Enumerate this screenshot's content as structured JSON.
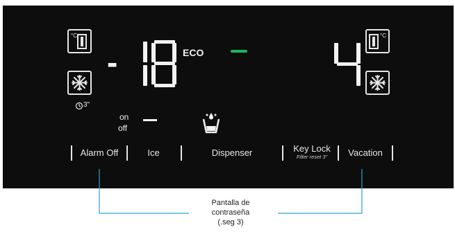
{
  "display": {
    "freezer_temp_digits": "18",
    "freezer_temp_sign": "-",
    "eco_label": "ECO",
    "fridge_temp_digit": "4",
    "eco_indicator_color": "#1db954",
    "hold_hint": "3\""
  },
  "ice_status": {
    "on_label": "on",
    "off_label": "off"
  },
  "controls": {
    "alarm_off": "Alarm Off",
    "ice": "Ice",
    "dispenser": "Dispenser",
    "key_lock": "Key Lock",
    "key_lock_sub": "Filter reset 3\"",
    "vacation": "Vacation"
  },
  "annotation": {
    "line1": "Pantalla de",
    "line2": "contraseña",
    "line3": "(.seg 3)",
    "line_color": "#2aa0d8"
  },
  "icons": {
    "freezer_temp": "thermometer-celsius-icon",
    "freezer_mode": "snowflake-icon",
    "fridge_temp": "thermometer-celsius-icon",
    "fridge_mode": "snowflake-icon",
    "dispenser": "water-glass-icon",
    "power_freeze_timer": "clock-timer-icon"
  },
  "colors": {
    "panel_bg": "#0d0d0d",
    "segment_fg": "#f2f2f2",
    "eco_green": "#1db954"
  }
}
